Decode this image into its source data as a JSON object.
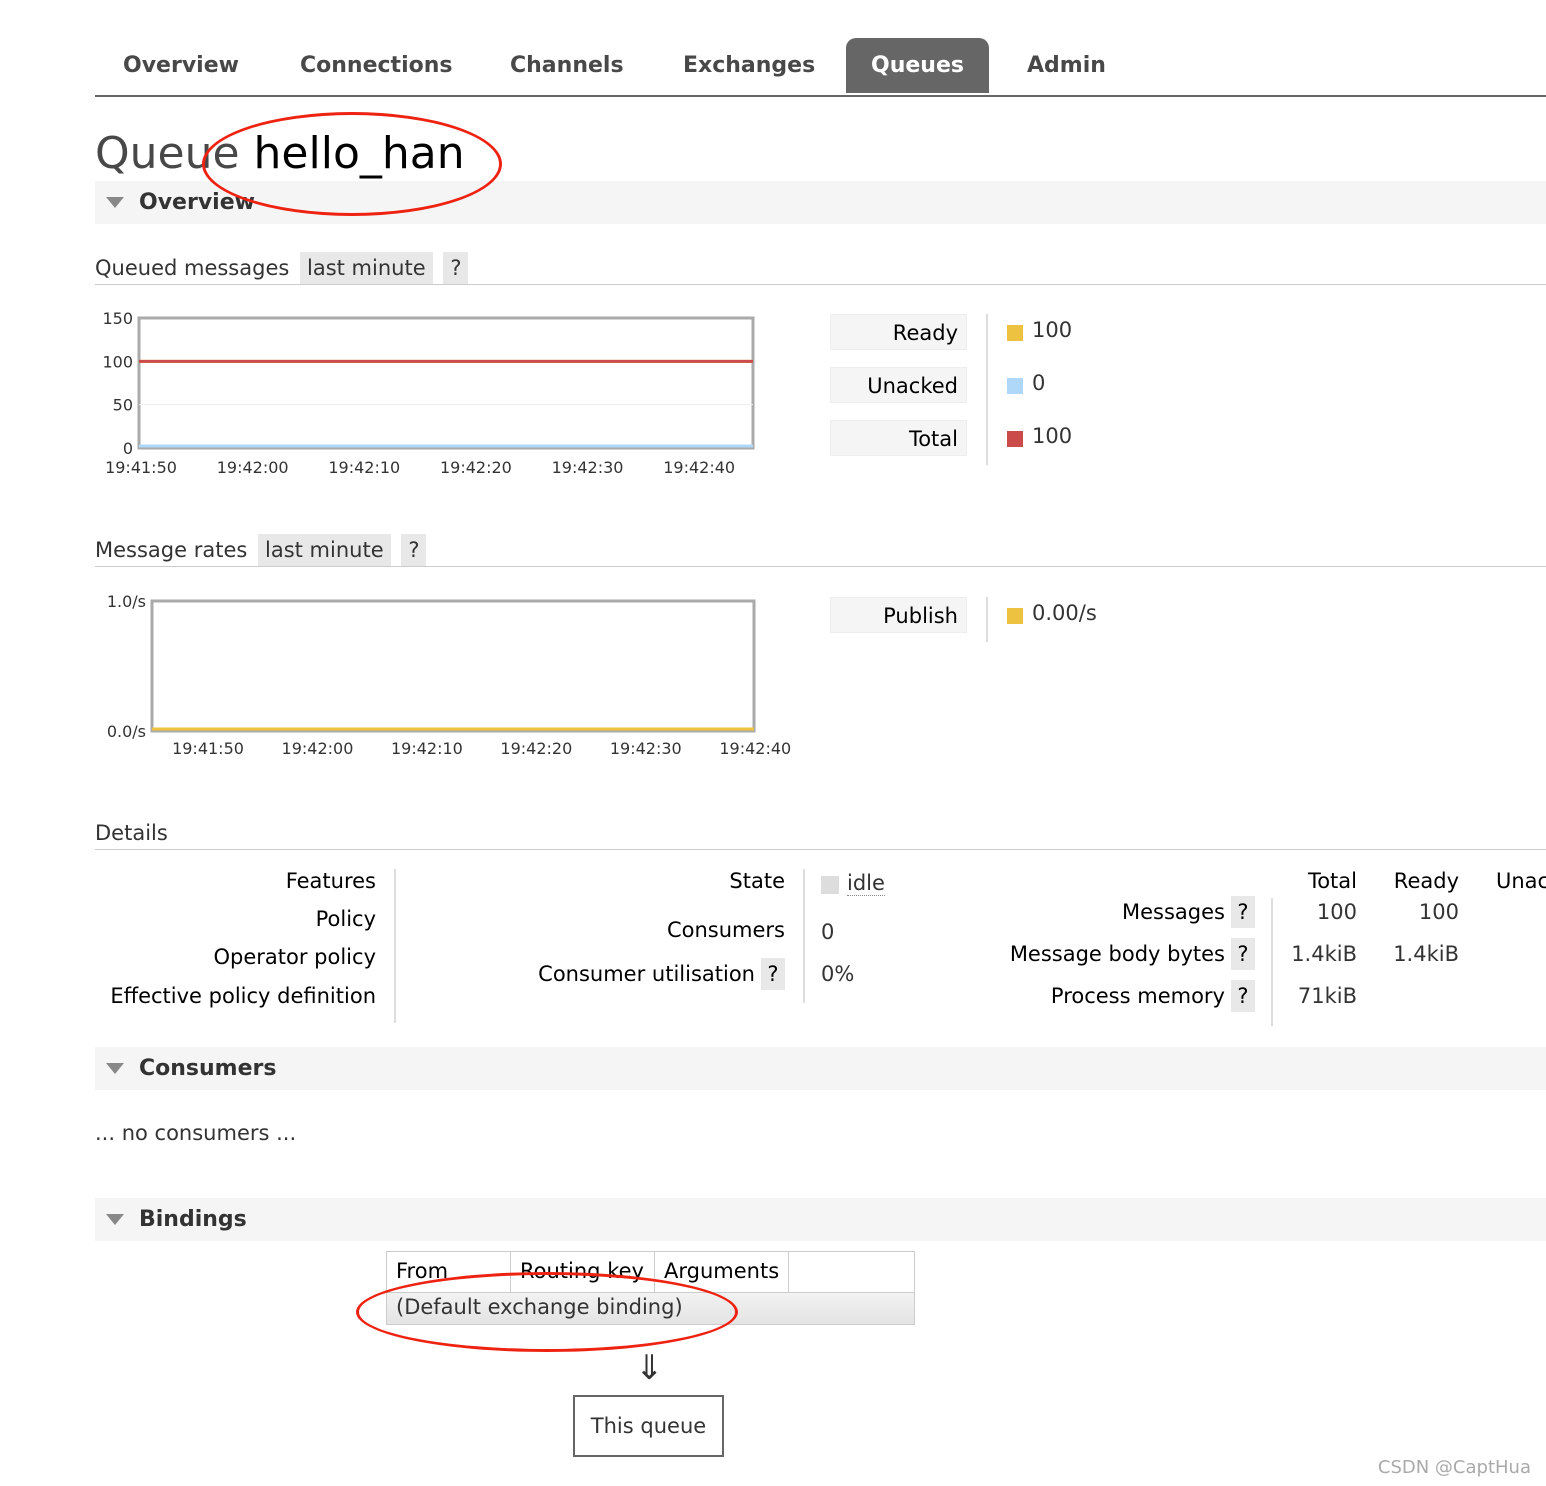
{
  "nav": {
    "tabs": [
      {
        "label": "Overview"
      },
      {
        "label": "Connections"
      },
      {
        "label": "Channels"
      },
      {
        "label": "Exchanges"
      },
      {
        "label": "Queues",
        "active": true
      },
      {
        "label": "Admin"
      }
    ]
  },
  "page": {
    "title_prefix": "Queue",
    "queue_name": "hello_han"
  },
  "overview": {
    "heading": "Overview",
    "queued": {
      "label": "Queued messages",
      "range": "last minute",
      "help": "?"
    },
    "rates": {
      "label": "Message rates",
      "range": "last minute",
      "help": "?"
    }
  },
  "legend_queued": [
    {
      "label": "Ready",
      "value": "100",
      "color": "#edc240"
    },
    {
      "label": "Unacked",
      "value": "0",
      "color": "#afd8f8"
    },
    {
      "label": "Total",
      "value": "100",
      "color": "#cb4b4b"
    }
  ],
  "legend_rates": [
    {
      "label": "Publish",
      "value": "0.00/s",
      "color": "#edc240"
    }
  ],
  "chart_data": [
    {
      "type": "line",
      "x": [
        "19:41:50",
        "19:42:00",
        "19:42:10",
        "19:42:20",
        "19:42:30",
        "19:42:40"
      ],
      "y_ticks": [
        "150",
        "100",
        "50",
        "0"
      ],
      "ylim": [
        0,
        150
      ],
      "grid": true,
      "series": [
        {
          "name": "Ready",
          "values": [
            100,
            100,
            100,
            100,
            100,
            100
          ],
          "color": "#edc240"
        },
        {
          "name": "Unacked",
          "values": [
            0,
            0,
            0,
            0,
            0,
            0
          ],
          "color": "#afd8f8"
        },
        {
          "name": "Total",
          "values": [
            100,
            100,
            100,
            100,
            100,
            100
          ],
          "color": "#cb4b4b"
        }
      ]
    },
    {
      "type": "line",
      "x": [
        "19:41:50",
        "19:42:00",
        "19:42:10",
        "19:42:20",
        "19:42:30",
        "19:42:40"
      ],
      "y_ticks": [
        "1.0/s",
        "0.0/s"
      ],
      "ylim": [
        0,
        1
      ],
      "grid": false,
      "series": [
        {
          "name": "Publish",
          "values": [
            0,
            0,
            0,
            0,
            0,
            0
          ],
          "color": "#edc240"
        }
      ]
    }
  ],
  "details": {
    "heading": "Details",
    "left_labels": [
      "Features",
      "Policy",
      "Operator policy",
      "Effective policy definition"
    ],
    "state_label": "State",
    "state_value": "idle",
    "consumers_label": "Consumers",
    "consumers_value": "0",
    "util_label": "Consumer utilisation",
    "util_help": "?",
    "util_value": "0%",
    "cols": [
      "Total",
      "Ready",
      "Unac"
    ],
    "rows": [
      {
        "label": "Messages",
        "help": "?",
        "total": "100",
        "ready": "100"
      },
      {
        "label": "Message body bytes",
        "help": "?",
        "total": "1.4kiB",
        "ready": "1.4kiB"
      },
      {
        "label": "Process memory",
        "help": "?",
        "total": "71kiB",
        "ready": ""
      }
    ]
  },
  "consumers": {
    "heading": "Consumers",
    "empty": "... no consumers ..."
  },
  "bindings": {
    "heading": "Bindings",
    "cols": [
      "From",
      "Routing key",
      "Arguments"
    ],
    "row": "(Default exchange binding)",
    "arrow": "⇓",
    "target": "This queue"
  },
  "watermark": "CSDN @CaptHua"
}
